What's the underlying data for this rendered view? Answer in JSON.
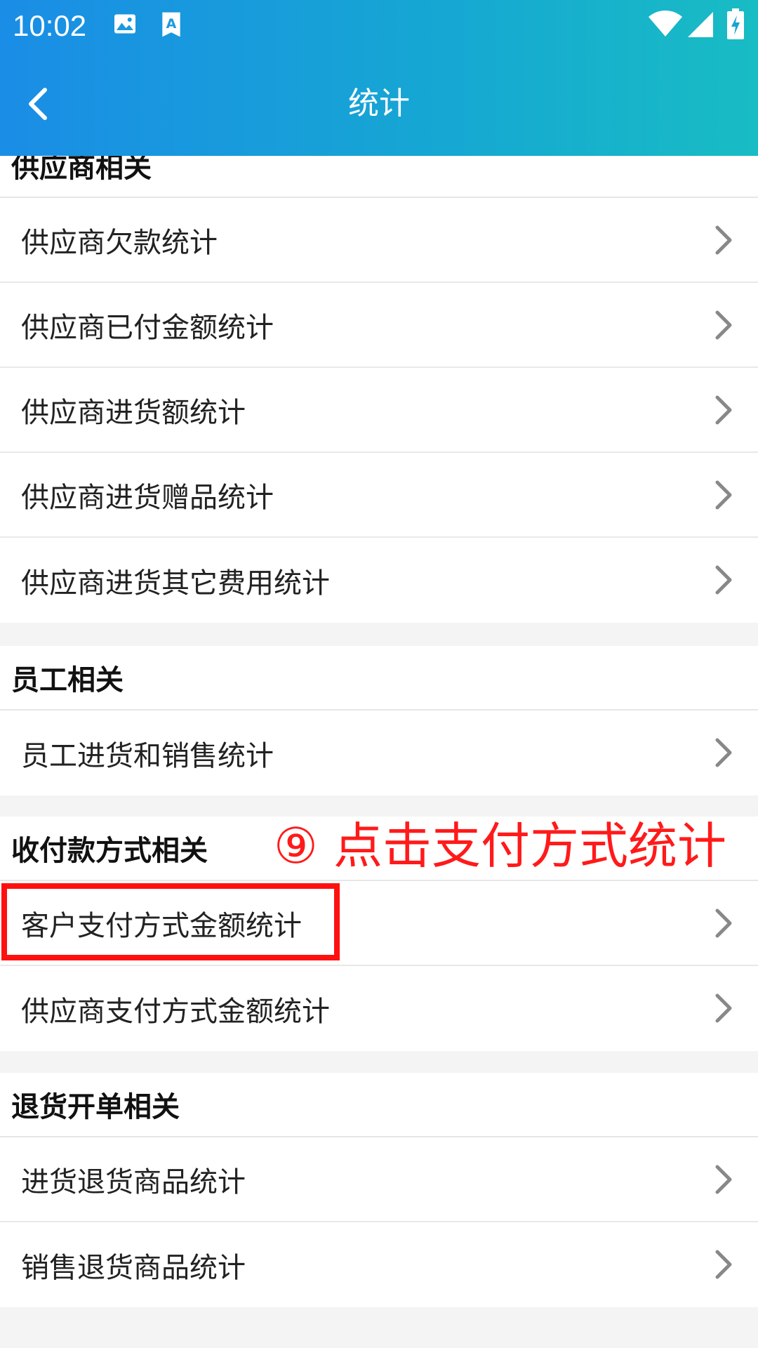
{
  "status_bar": {
    "time": "10:02"
  },
  "header": {
    "title": "统计"
  },
  "sections": [
    {
      "id": "supplier",
      "header": "供应商相关",
      "items": [
        "供应商欠款统计",
        "供应商已付金额统计",
        "供应商进货额统计",
        "供应商进货赠品统计",
        "供应商进货其它费用统计"
      ]
    },
    {
      "id": "employee",
      "header": "员工相关",
      "items": [
        "员工进货和销售统计"
      ]
    },
    {
      "id": "payment",
      "header": "收付款方式相关",
      "items": [
        "客户支付方式金额统计",
        "供应商支付方式金额统计"
      ]
    },
    {
      "id": "returns",
      "header": "退货开单相关",
      "items": [
        "进货退货商品统计",
        "销售退货商品统计"
      ]
    }
  ],
  "annotation": {
    "text": "⑨ 点击支付方式统计"
  },
  "colors": {
    "header_start": "#1a8de6",
    "header_end": "#18bcc4",
    "annotation": "#ff1a1a"
  }
}
